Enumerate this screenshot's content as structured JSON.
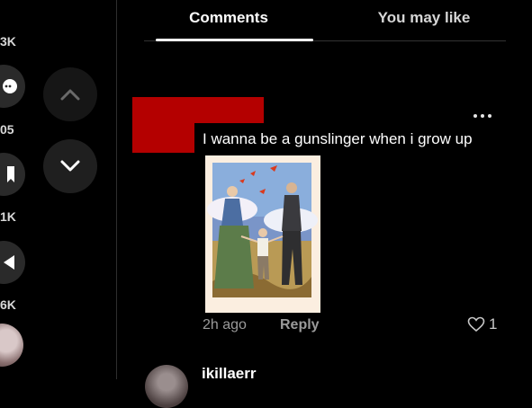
{
  "rail": {
    "counts": [
      "3K",
      "05",
      "1K",
      "6K"
    ]
  },
  "tabs": [
    {
      "label": "Comments"
    },
    {
      "label": "You may like"
    }
  ],
  "comment": {
    "text": "I wanna be a gunslinger when i grow up",
    "time": "2h ago",
    "reply_label": "Reply",
    "likes": "1"
  },
  "next_comment": {
    "username": "ikillaerr"
  },
  "colors": {
    "redaction": "#b40000",
    "background": "#000000"
  },
  "icons": {
    "more": "more-options-icon",
    "heart": "heart-icon",
    "up": "chevron-up-icon",
    "down": "chevron-down-icon"
  }
}
